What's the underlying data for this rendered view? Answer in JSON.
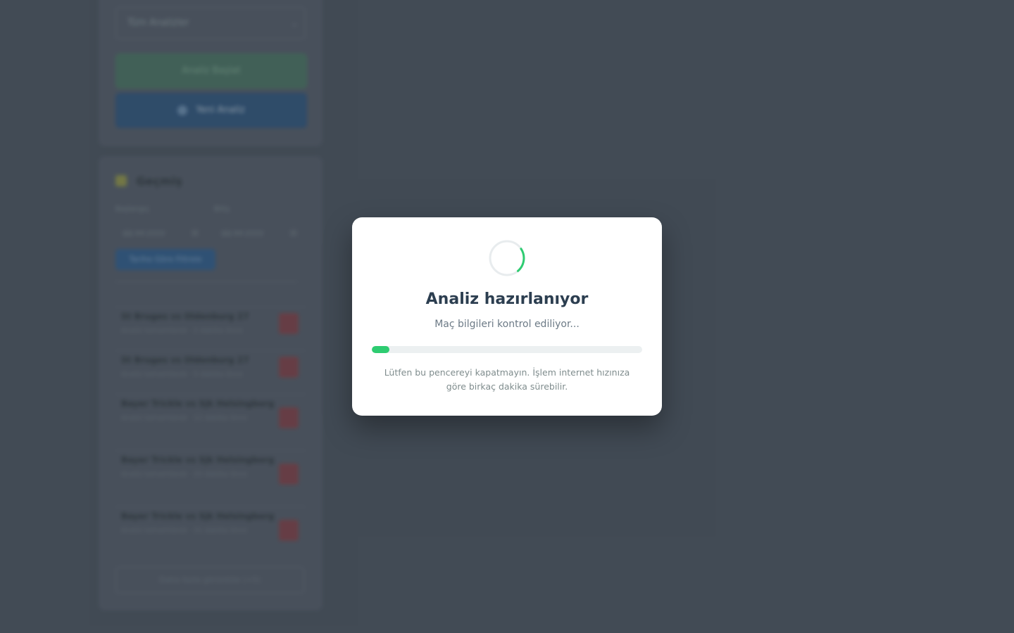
{
  "background": {
    "select_value": "Tüm Analizler",
    "green_button_label": "Analiz Başlat",
    "blue_button_label": "Yeni Analiz",
    "history_heading": "Geçmiş",
    "date_from_label": "Başlangıç",
    "date_to_label": "Bitiş",
    "date_from_value": "gg.aa.yyyy",
    "date_to_value": "gg.aa.yyyy",
    "filter_button_label": "Tarihe Göre Filtrele",
    "items": [
      {
        "title": "St Bruges vs Oldenburg 27",
        "subtitle": "Analiz tamamlandı · 2 dakika önce"
      },
      {
        "title": "St Bruges vs Oldenburg 27",
        "subtitle": "Analiz tamamlandı · 5 dakika önce"
      },
      {
        "title": "Bayer Trickle vs Sjk Helsingborg",
        "subtitle": "Analiz tamamlandı · 12 dakika önce"
      },
      {
        "title": "Bayer Trickle vs Sjk Helsingborg",
        "subtitle": "Analiz tamamlandı · 20 dakika önce"
      },
      {
        "title": "Bayer Trickle vs Sjk Helsingborg",
        "subtitle": "Analiz tamamlandı · 31 dakika önce"
      }
    ],
    "more_button_label": "Daha fazla görüntüle (+5)"
  },
  "modal": {
    "title": "Analiz hazırlanıyor",
    "subtitle": "Maç bilgileri kontrol ediliyor...",
    "progress_percent": 6.5,
    "note": "Lütfen bu pencereyi kapatmayın. İşlem internet hızınıza göre birkaç dakika sürebilir.",
    "spinner_icon": "loading-spinner-icon",
    "accent_color": "#2ecc71",
    "title_color": "#2c3e50"
  }
}
